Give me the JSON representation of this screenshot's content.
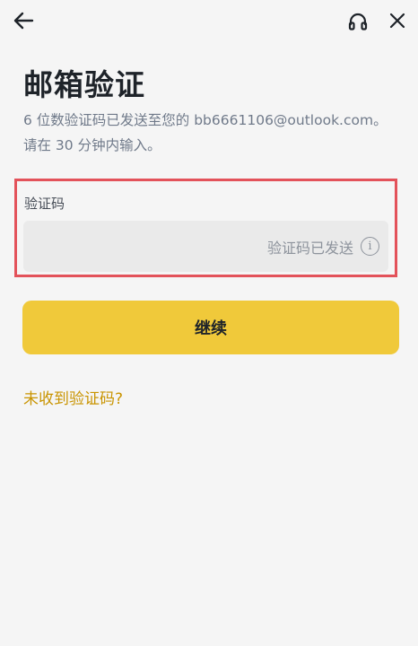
{
  "topbar": {
    "back_icon": "arrow-left-icon",
    "support_icon": "headset-icon",
    "close_icon": "close-icon"
  },
  "page": {
    "title": "邮箱验证",
    "desc_line1": "6 位数验证码已发送至您的 bb6661106@outlook.com。",
    "desc_line2": "请在 30 分钟内输入。"
  },
  "field": {
    "label": "验证码",
    "status_text": "验证码已发送",
    "info_icon": "info-icon",
    "highlight_color": "#e3525a"
  },
  "actions": {
    "continue_label": "继续",
    "resend_link": "未收到验证码?"
  },
  "colors": {
    "accent": "#f0c93a",
    "link": "#c99400",
    "background": "#f5f5f5"
  }
}
